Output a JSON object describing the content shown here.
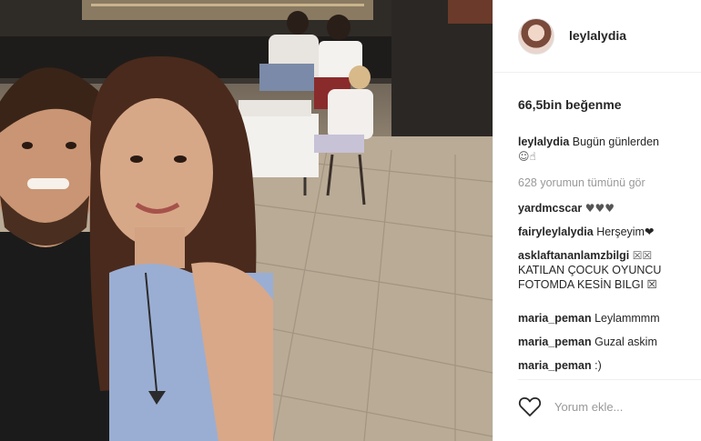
{
  "post": {
    "username": "leylalydia",
    "likes_text": "66,5bin beğenme",
    "caption_user": "leylalydia",
    "caption_text": "Bugün günlerden",
    "caption_emoji": "☺☝",
    "view_all_comments": "628 yorumun tümünü gör",
    "comments": [
      {
        "user": "yardmcscar",
        "text": "♥♥♥"
      },
      {
        "user": "fairyleylalydia",
        "text": "Herşeyim❤"
      },
      {
        "user": "asklaftananlamzbilgi",
        "text": "",
        "boxes": "☒☒",
        "extra_lines": [
          "KATILAN ÇOCUK OYUNCU",
          "FOTOMDA KESİN BILGI ☒"
        ]
      },
      {
        "user": "maria_peman",
        "text": "Leylammmm"
      },
      {
        "user": "maria_peman",
        "text": "Guzal askim"
      },
      {
        "user": "maria_peman",
        "text": ":)"
      }
    ],
    "comment_placeholder": "Yorum ekle..."
  },
  "icons": {
    "like": "heart-icon",
    "avatar": "profile-avatar"
  },
  "colors": {
    "text": "#262626",
    "muted": "#999999",
    "border": "#efefef"
  }
}
